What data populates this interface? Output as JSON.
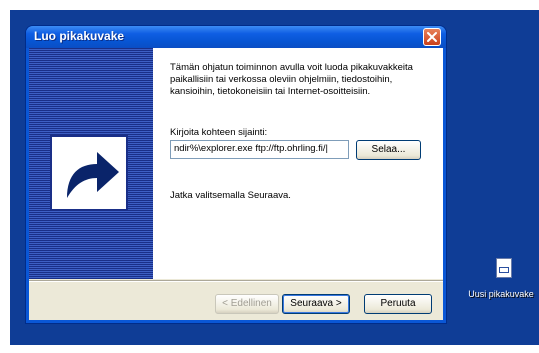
{
  "window": {
    "title": "Luo pikakuvake"
  },
  "wizard": {
    "intro": "Tämän ohjatun toiminnon avulla voit luoda pikakuvakkeita paikallisiin tai verkossa oleviin ohjelmiin, tiedostoihin, kansioihin, tietokoneisiin tai Internet-osoitteisiin.",
    "location_label": "Kirjoita kohteen sijainti:",
    "location_value": "ndir%\\explorer.exe ftp://ftp.ohrling.fi/|",
    "browse_label": "Selaa...",
    "continue_text": "Jatka valitsemalla Seuraava."
  },
  "buttons": {
    "back": "< Edellinen",
    "next": "Seuraava >",
    "cancel": "Peruuta"
  },
  "desktop": {
    "icon_label": "Uusi pikakuvake",
    "icon_name": "shortcut-file-icon"
  },
  "colors": {
    "desktop": "#0f3d96",
    "titlebar": "#0a57d6",
    "dialog_face": "#ece9d8",
    "close_button": "#c9401c"
  }
}
